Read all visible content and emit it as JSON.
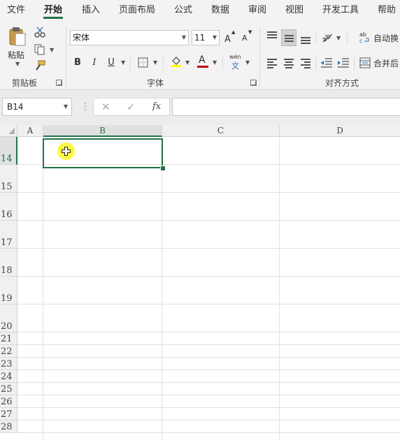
{
  "tabs": [
    "文件",
    "开始",
    "插入",
    "页面布局",
    "公式",
    "数据",
    "审阅",
    "视图",
    "开发工具",
    "帮助"
  ],
  "active_tab": "开始",
  "ribbon": {
    "clipboard": {
      "paste_label": "粘贴",
      "group_label": "剪贴板"
    },
    "font": {
      "font_name": "宋体",
      "font_size": "11",
      "grow_label": "A",
      "shrink_label": "A",
      "bold_label": "B",
      "italic_label": "I",
      "underline_label": "U",
      "fontcolor_label": "A",
      "phonetic_top": "wén",
      "phonetic_bottom": "文",
      "group_label": "字体"
    },
    "alignment": {
      "wrap_label": "自动换",
      "merge_label": "合并后",
      "group_label": "对齐方式"
    }
  },
  "formula_bar": {
    "name_box": "B14",
    "fx_label": "fx",
    "formula_value": ""
  },
  "columns": [
    "A",
    "B",
    "C",
    "D"
  ],
  "selected_column": "B",
  "rows": [
    "14",
    "15",
    "16",
    "17",
    "18",
    "19",
    "20",
    "21",
    "22",
    "23",
    "24",
    "25",
    "26",
    "27",
    "28"
  ],
  "selected_row": "14",
  "colors": {
    "accent": "#217346",
    "font_color_bar": "#c00000",
    "highlight": "#ffff00"
  }
}
